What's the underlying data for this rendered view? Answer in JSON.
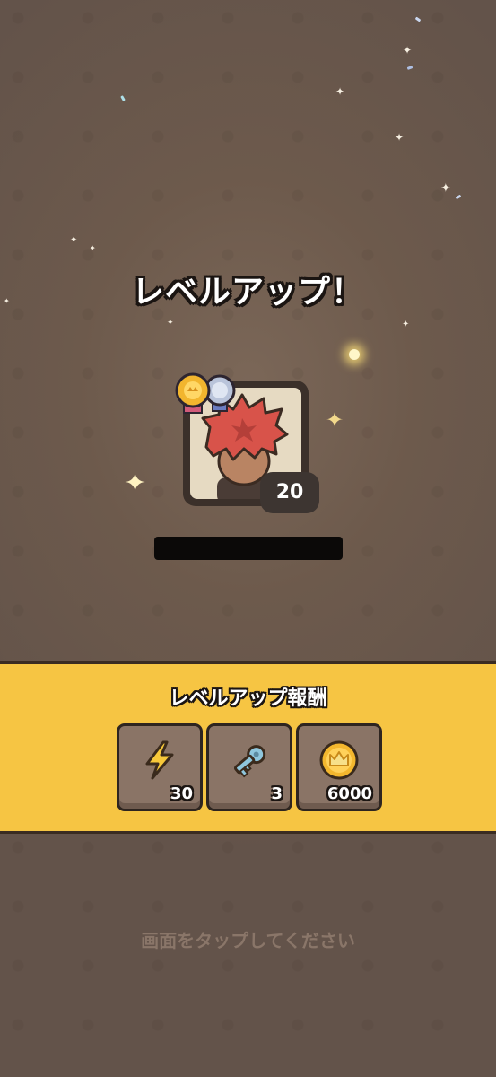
{
  "title": "レベルアップ！",
  "player": {
    "level": "20",
    "avatar": "red-haired-character-portrait",
    "medals": [
      "gold-medal-icon",
      "silver-medal-icon"
    ],
    "name_redacted": true
  },
  "rewards": {
    "title": "レベルアップ報酬",
    "items": [
      {
        "icon": "lightning-bolt-icon",
        "count": "30"
      },
      {
        "icon": "key-icon",
        "count": "3"
      },
      {
        "icon": "crown-coin-icon",
        "count": "6000"
      }
    ]
  },
  "hint": "画面をタップしてください",
  "colors": {
    "background": "#6d5a4c",
    "rewards_band": "#f6c543",
    "reward_slot": "#8a7466",
    "hint_text": "#8a7669"
  }
}
